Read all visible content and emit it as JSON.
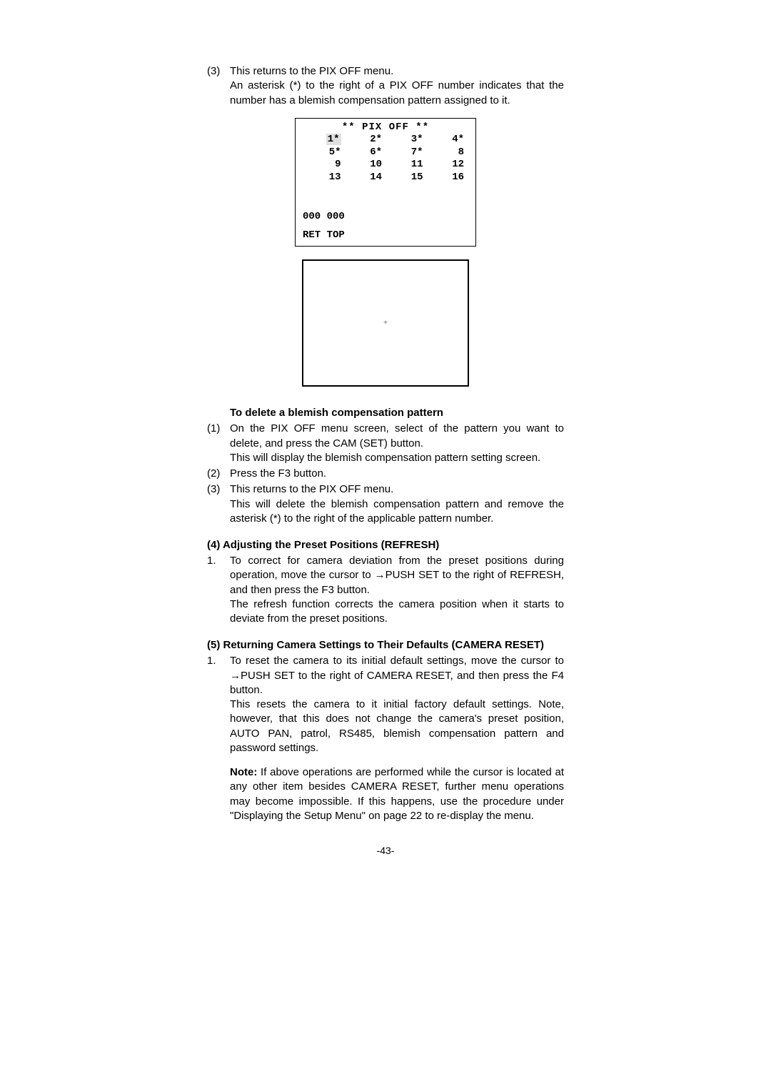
{
  "sec1": {
    "n3": "(3)",
    "l3a": "This returns to the PIX OFF menu.",
    "l3b": "An asterisk (*) to the right of a PIX OFF number indicates that the number has a blemish compensation pattern assigned to it."
  },
  "menu": {
    "title": "** PIX OFF **",
    "r1c1": "1*",
    "r1c2": "2*",
    "r1c3": "3*",
    "r1c4": "4*",
    "r2c1": "5*",
    "r2c2": "6*",
    "r2c3": "7*",
    "r2c4": "8",
    "r3c1": "9",
    "r3c2": "10",
    "r3c3": "11",
    "r3c4": "12",
    "r4c1": "13",
    "r4c2": "14",
    "r4c3": "15",
    "r4c4": "16",
    "coord": "000 000",
    "bottom": "RET TOP"
  },
  "cross": "+",
  "del": {
    "title": "To delete a blemish compensation pattern",
    "n1": "(1)",
    "l1a": "On the PIX OFF menu screen, select of the pattern you want to delete, and press the CAM (SET) button.",
    "l1b": "This will display the blemish compensation pattern setting screen.",
    "n2": "(2)",
    "l2": "Press the F3 button.",
    "n3": "(3)",
    "l3a": "This returns to the PIX OFF menu.",
    "l3b": "This will delete the blemish compensation pattern and remove the asterisk (*) to the right of the applicable pattern number."
  },
  "sec4": {
    "head": "(4) Adjusting the Preset Positions (REFRESH)",
    "n1": "1.",
    "l1a": "To correct for camera deviation from the preset positions during operation, move the cursor to →PUSH SET to the right of REFRESH, and then press the F3 button.",
    "l1b": "The refresh function corrects the camera position when it starts to deviate from the preset positions."
  },
  "sec5": {
    "head": "(5) Returning Camera Settings to Their Defaults (CAMERA RESET)",
    "n1": "1.",
    "l1a": "To reset the camera to its initial default settings, move the cursor to →PUSH SET to the right of CAMERA RESET, and then press the F4 button.",
    "l1b": "This resets the camera to it initial factory default settings. Note, however, that this does not change the camera's preset position, AUTO PAN, patrol, RS485, blemish compensation pattern and password settings.",
    "noteLabel": "Note:",
    "note": " If above operations are performed while the cursor is located at any other item besides CAMERA RESET, further menu operations may become impossible. If this happens, use the procedure under \"Displaying the Setup Menu\" on page 22 to re-display the menu."
  },
  "pagenum": "-43-"
}
